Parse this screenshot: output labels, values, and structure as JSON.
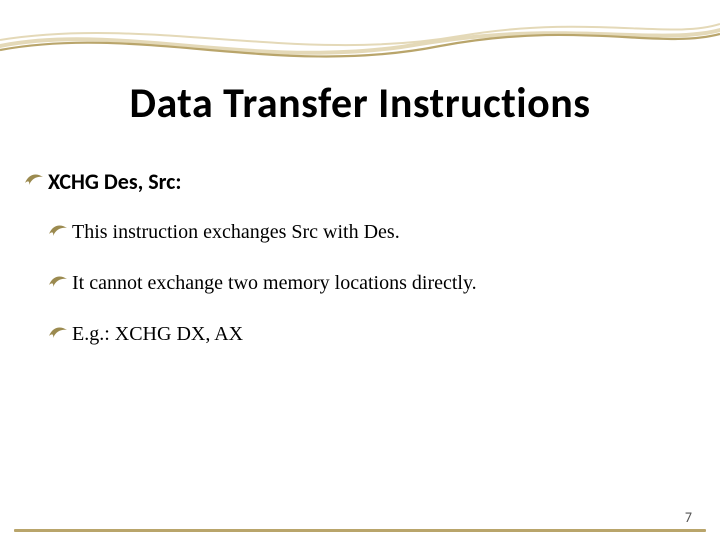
{
  "slide": {
    "title": "Data Transfer Instructions",
    "items": [
      {
        "level": 1,
        "text": "XCHG Des, Src:"
      },
      {
        "level": 2,
        "text": "This instruction exchanges Src with Des."
      },
      {
        "level": 2,
        "text": "It cannot exchange two memory locations directly."
      },
      {
        "level": 2,
        "text": "E.g.: XCHG DX, AX"
      }
    ],
    "page_number": "7"
  },
  "colors": {
    "accent": "#b9a56b",
    "accent_light": "#e4d9b8",
    "swish": "#9b8a4f"
  }
}
